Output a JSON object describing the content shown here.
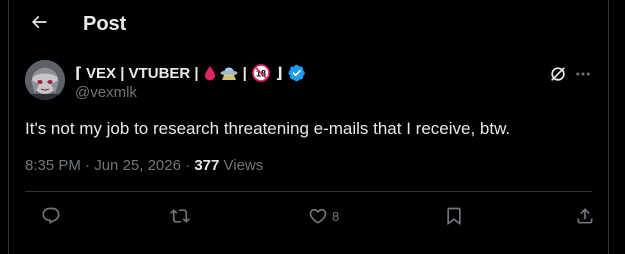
{
  "header": {
    "back_icon": "arrow-left-icon",
    "title": "Post"
  },
  "author": {
    "avatar_icon": "avatar-image",
    "name_prefix": "⌈ VEX | VTUBER |",
    "name_icons": [
      "blood-drop-emoji",
      "ufo-emoji",
      "no-under-18-emoji"
    ],
    "name_suffix": "⌋",
    "verified_icon": "verified-badge-icon",
    "handle": "@vexmlk"
  },
  "tweet": {
    "text": "It's not my job to research threatening e-mails that I receive, btw."
  },
  "meta": {
    "time": "8:35 PM",
    "separator": "·",
    "date": "Jun 25, 2026",
    "views_count": "377",
    "views_label": "Views"
  },
  "actions": {
    "reply_icon": "reply-icon",
    "repost_icon": "repost-icon",
    "like_icon": "heart-icon",
    "like_count": "8",
    "bookmark_icon": "bookmark-icon",
    "share_icon": "share-icon"
  },
  "toolbar": {
    "grok_icon": "grok-icon",
    "more_icon": "more-dots-icon"
  },
  "colors": {
    "background": "#000000",
    "text_primary": "#e7e9ea",
    "text_secondary": "#71767b",
    "border": "#2f3336",
    "verified": "#1d9bf0",
    "blood": "#e0245e"
  }
}
